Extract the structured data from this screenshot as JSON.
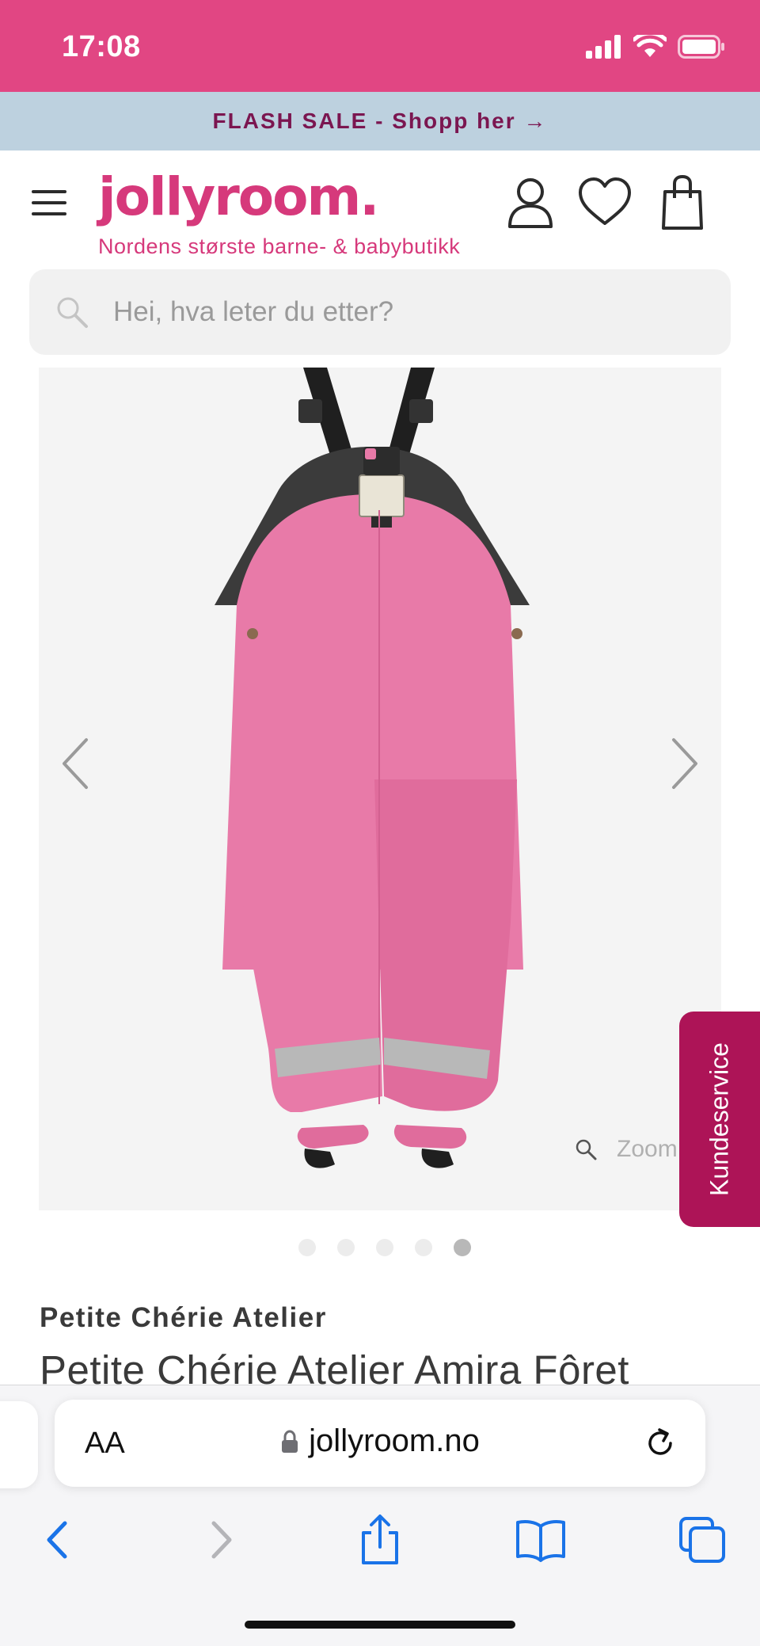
{
  "status_bar": {
    "time": "17:08",
    "icons": [
      "cellular-signal-icon",
      "wifi-icon",
      "battery-icon"
    ]
  },
  "promo": {
    "text": "FLASH SALE - Shopp her →"
  },
  "header": {
    "logo_text": "jollyroom.",
    "tagline": "Nordens største barne- & babybutikk",
    "icons": [
      "menu-icon",
      "account-icon",
      "wishlist-heart-icon",
      "shopping-bag-icon"
    ]
  },
  "search": {
    "placeholder": "Hei, hva leter du etter?"
  },
  "gallery": {
    "zoom_label": "Zoom",
    "slide_count": 5,
    "active_slide": 5,
    "product_color": "#e87aa8"
  },
  "customer_service": {
    "label": "Kundeservice"
  },
  "product": {
    "brand": "Petite Chérie Atelier",
    "title": "Petite Chérie Atelier Amira Fôret"
  },
  "browser": {
    "text_size_label": "AA",
    "url": "jollyroom.no",
    "toolbar_icons": [
      "back-icon",
      "forward-icon",
      "share-icon",
      "bookmarks-icon",
      "tabs-icon"
    ]
  },
  "colors": {
    "brand_pink": "#e14683",
    "logo_pink": "#d6397b",
    "promo_bg": "#bdd1df",
    "promo_text": "#7b1650",
    "kundeservice_bg": "#ad1457",
    "ios_blue": "#1a73e8"
  }
}
